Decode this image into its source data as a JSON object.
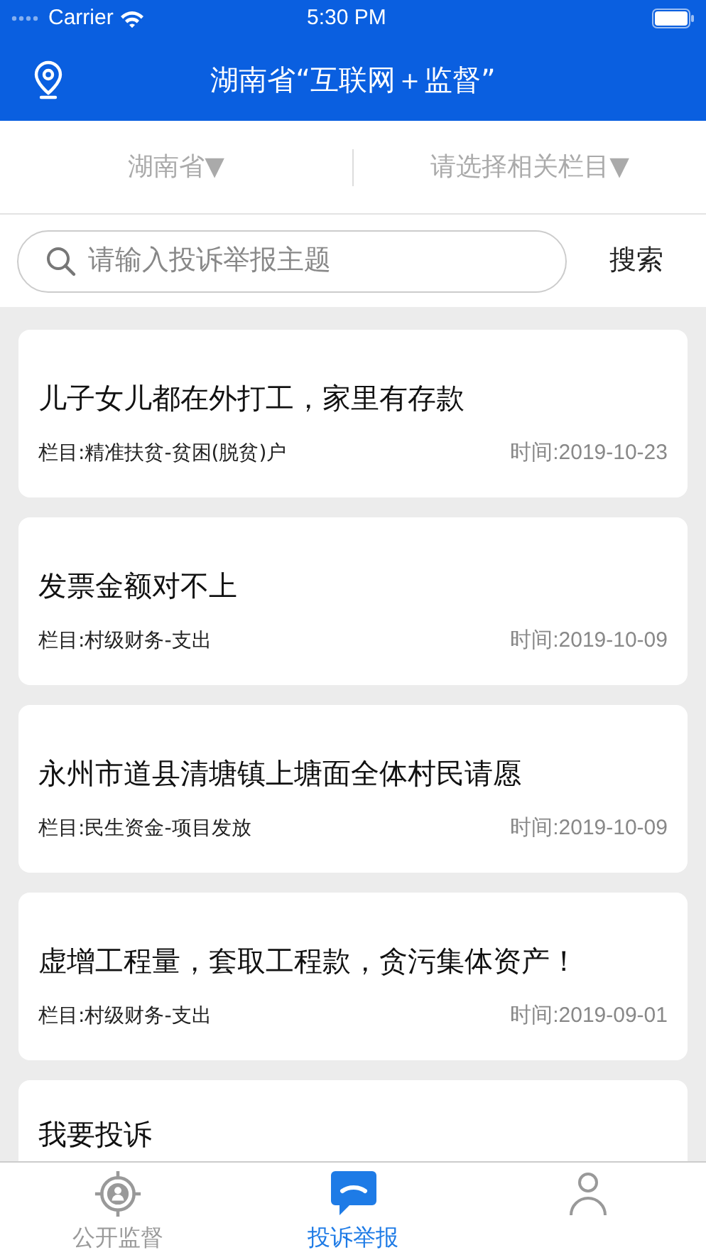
{
  "status_bar": {
    "carrier": "Carrier",
    "time": "5:30 PM"
  },
  "header": {
    "title": "湖南省“互联网＋监督”"
  },
  "filters": [
    {
      "label": "湖南省▼"
    },
    {
      "label": "请选择相关栏目▼"
    }
  ],
  "search": {
    "placeholder": "请输入投诉举报主题",
    "button": "搜索"
  },
  "cards": [
    {
      "title": "儿子女儿都在外打工，家里有存款",
      "category": "栏目:精准扶贫-贫困(脱贫)户",
      "time": "时间:2019-10-23"
    },
    {
      "title": "发票金额对不上",
      "category": "栏目:村级财务-支出",
      "time": "时间:2019-10-09"
    },
    {
      "title": "永州市道县清塘镇上塘面全体村民请愿",
      "category": "栏目:民生资金-项目发放",
      "time": "时间:2019-10-09"
    },
    {
      "title": "虚增工程量，套取工程款，贪污集体资产！",
      "category": "栏目:村级财务-支出",
      "time": "时间:2019-09-01"
    },
    {
      "title": "我要投诉"
    }
  ],
  "tabs": [
    {
      "label": "公开监督",
      "kind": "target",
      "selected": false
    },
    {
      "label": "投诉举报",
      "kind": "chat",
      "selected": true
    },
    {
      "kind": "person",
      "selected": false
    }
  ]
}
